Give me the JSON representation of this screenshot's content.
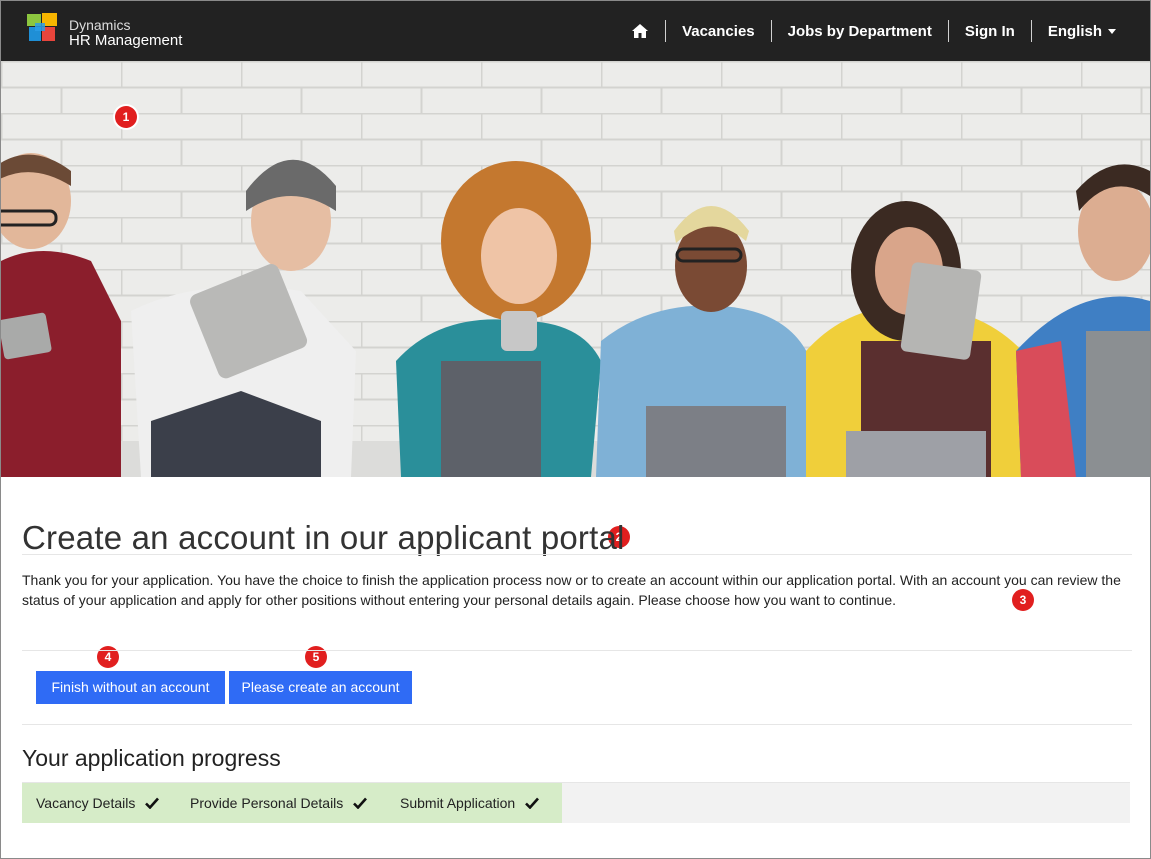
{
  "header": {
    "brand_line1": "Dynamics",
    "brand_line2": "HR Management",
    "nav": {
      "home_icon": "home-icon",
      "vacancies": "Vacancies",
      "jobs_by_department": "Jobs by Department",
      "sign_in": "Sign In",
      "language": "English"
    }
  },
  "markers": [
    "1",
    "2",
    "3",
    "4",
    "5"
  ],
  "content": {
    "title": "Create an account in our applicant portal",
    "paragraph": "Thank you for your application. You have the choice to finish the application process now or to create an account within our application portal. With an account you can review the status of your application and apply for other positions without entering your personal details again. Please choose how you want to continue.",
    "buttons": {
      "finish": "Finish without an account",
      "create": "Please create an account"
    }
  },
  "progress": {
    "title": "Your application progress",
    "steps": [
      {
        "label": "Vacancy Details"
      },
      {
        "label": "Provide Personal Details"
      },
      {
        "label": "Submit Application"
      }
    ]
  },
  "colors": {
    "header_bg": "#222222",
    "button_bg": "#2f6bf5",
    "step_bg": "#d6ecc8",
    "marker": "#e11f1f"
  }
}
